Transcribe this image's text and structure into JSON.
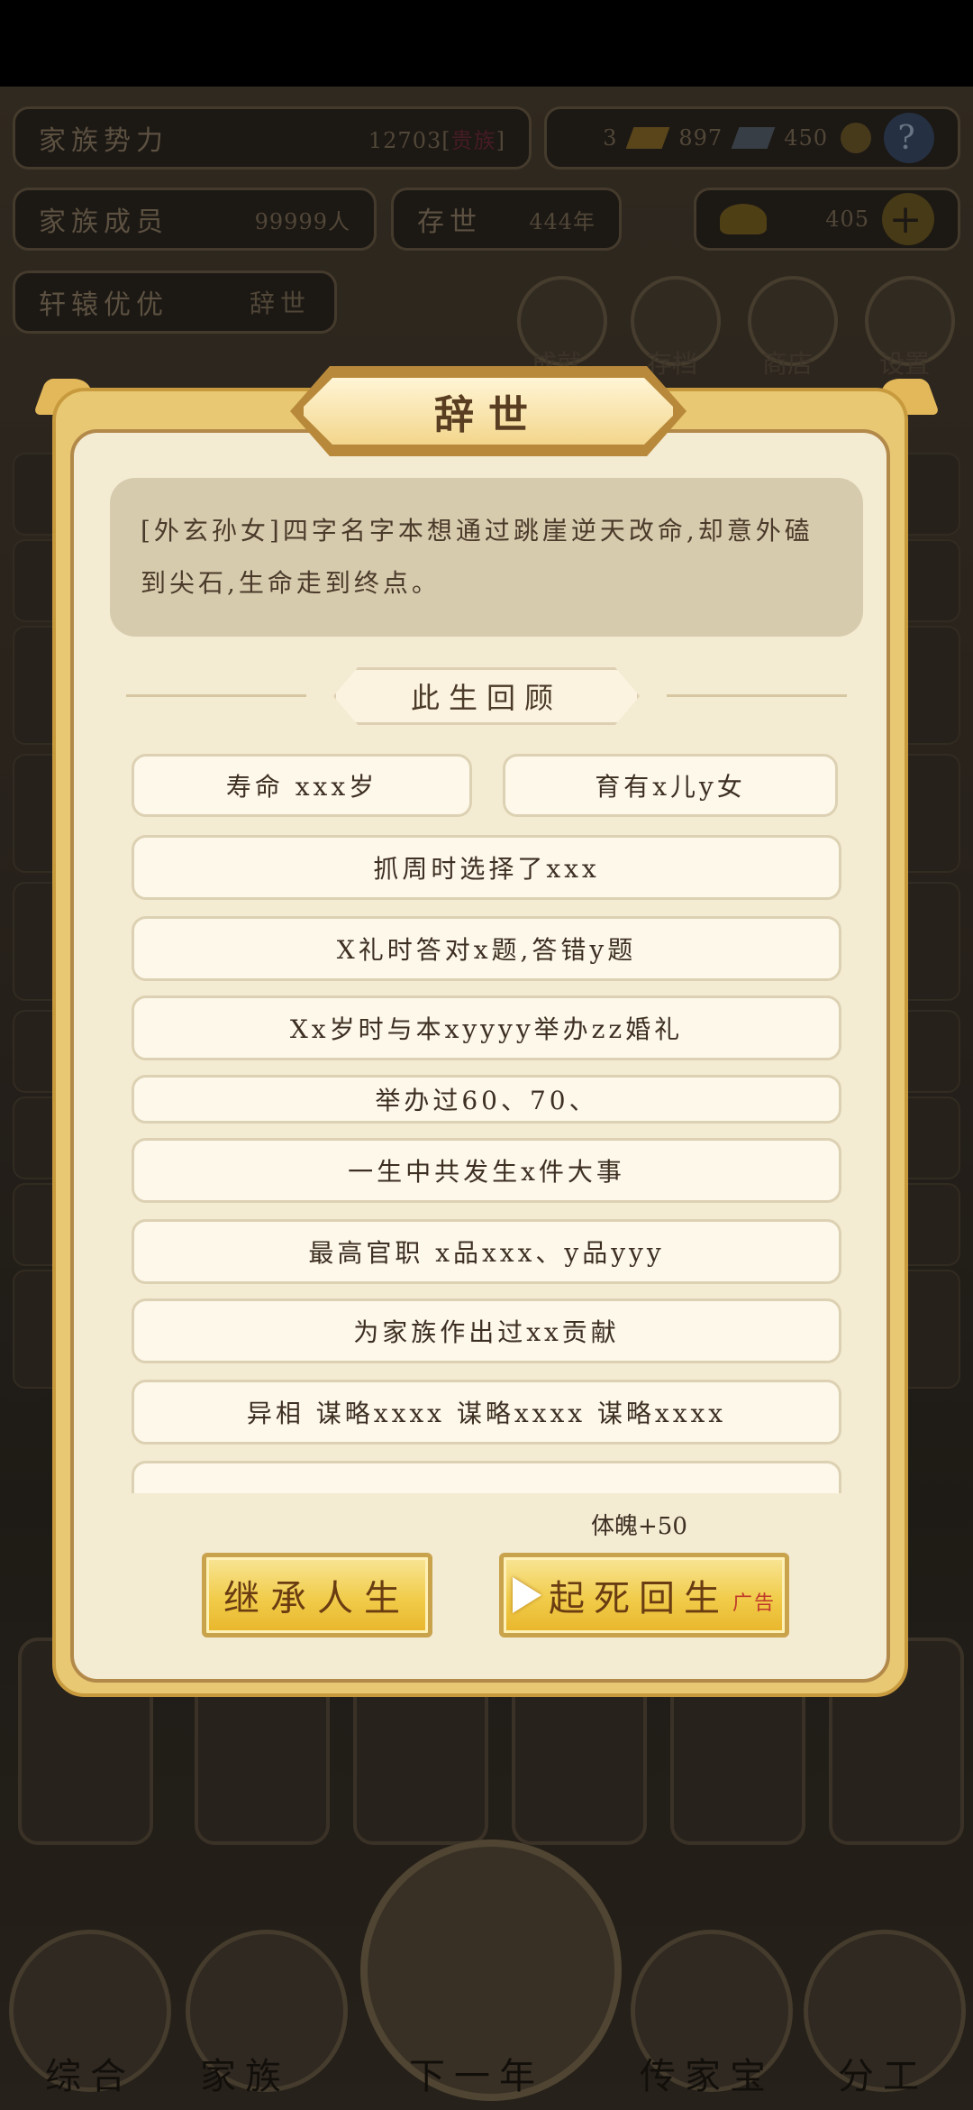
{
  "hud": {
    "family_power_label": "家族势力",
    "family_power_value": "12703",
    "family_power_bracket_open": "[",
    "family_power_rank": "贵族",
    "family_power_bracket_close": "]",
    "currency_a": "3",
    "currency_b": "897",
    "currency_c": "450",
    "family_members_label": "家族成员",
    "family_members_value": "99999人",
    "alive_label": "存世",
    "alive_value": "444年",
    "gold_value": "405",
    "person_name": "轩辕优优",
    "person_status": "辞世",
    "icon_labels": [
      "成就",
      "存档",
      "商店",
      "设置"
    ]
  },
  "bottom_nav": [
    "综合",
    "家族",
    "下一年",
    "传家宝",
    "分工"
  ],
  "dialog": {
    "title": "辞世",
    "description": "[外玄孙女]四字名字本想通过跳崖逆天改命,却意外磕到尖石,生命走到终点。",
    "section_title": "此生回顾",
    "stats": [
      "寿命 xxx岁",
      "育有x儿y女",
      "抓周时选择了xxx",
      "X礼时答对x题,答错y题",
      "Xx岁时与本xyyyy举办zz婚礼",
      "举办过60、70、",
      "一生中共发生x件大事",
      "最高官职 x品xxx、y品yyy",
      "为家族作出过xx贡献",
      "异相 谋略xxxx 谋略xxxx 谋略xxxx"
    ],
    "reward": "体魄+50",
    "inherit_button": "继承人生",
    "revive_button": "起死回生",
    "ad_tag": "广告"
  }
}
